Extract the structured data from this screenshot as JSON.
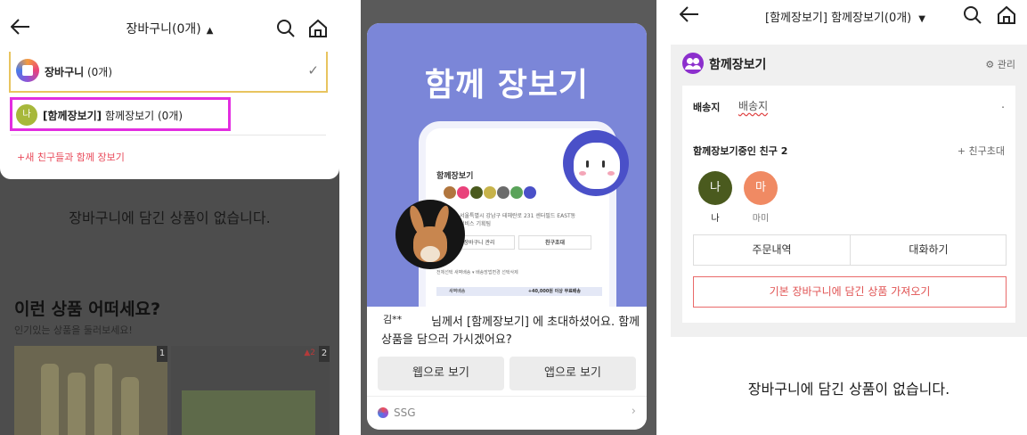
{
  "panel1": {
    "header_title": "장바구니(0개)",
    "caret": "▲",
    "cart_row": {
      "name": "장바구니",
      "count": " (0개)",
      "check": "✓"
    },
    "group_row": {
      "avatar": "나",
      "name": "[함께장보기]",
      "rest": " 함께장보기 (0개)"
    },
    "new_friends": "+새 친구들과 함께 장보기",
    "empty_message": "장바구니에 담긴 상품이 없습니다.",
    "rec_title": "이런 상품 어떠세요?",
    "rec_subtitle": "인기있는 상품을 둘러보세요!",
    "products": [
      {
        "rank": "1"
      },
      {
        "rank": "2",
        "change": "▲2"
      }
    ]
  },
  "panel2": {
    "promo_title": "함께 장보기",
    "mock": {
      "title": "함께장보기",
      "address": "서울특별시 강남구 테헤란로 231 센터필드 EAST동\n서비스 기획팀",
      "btn_manage": "장바구니 관리",
      "btn_invite": "친구초대",
      "row": "전체선택   새벽배송 ▾   배송방법변경   선택삭제",
      "bar_label": "새벽배송",
      "bar_amount": "+40,000원 이상 무료배송"
    },
    "inviter": "김**",
    "invite_message": "님께서 [함께장보기] 에 초대하셨어요. 함께 상품을 담으러 가시겠어요?",
    "btn_web": "웹으로 보기",
    "btn_app": "앱으로 보기",
    "brand": "SSG",
    "arrow": "›",
    "colors": {
      "promo_bg": "#7b86d8"
    }
  },
  "panel3": {
    "header_title": "[함께장보기] 함께장보기(0개)",
    "caret": "▼",
    "group_title": "함께장보기",
    "manage": "⚙ 관리",
    "ship_label": "배송지",
    "ship_value": "배송지",
    "ship_dot": ".",
    "friends_title": "함께장보기중인 친구 2",
    "invite": "+ 친구초대",
    "friends": [
      {
        "initial": "나",
        "name": "나",
        "color": "#4a5a1e"
      },
      {
        "initial": "마",
        "name": "마미",
        "color": "#f08a63"
      }
    ],
    "tab_orders": "주문내역",
    "tab_chat": "대화하기",
    "load_btn": "기본 장바구니에 담긴 상품 가져오기",
    "empty_message": "장바구니에 담긴 상품이 없습니다."
  }
}
